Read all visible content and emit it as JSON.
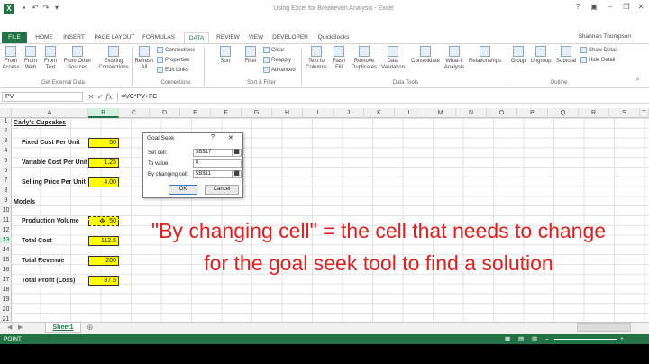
{
  "window": {
    "title": "Using Excel for Breakeven Analysis - Excel",
    "user": "Shannan Thompson"
  },
  "tabs": [
    "FILE",
    "HOME",
    "INSERT",
    "PAGE LAYOUT",
    "FORMULAS",
    "DATA",
    "REVIEW",
    "VIEW",
    "DEVELOPER",
    "QuickBooks"
  ],
  "active_tab": "DATA",
  "ribbon": {
    "get_external": {
      "buttons": [
        "From Access",
        "From Web",
        "From Text",
        "From Other Sources",
        "Existing Connections"
      ],
      "label": "Get External Data"
    },
    "connections": {
      "refresh": "Refresh All",
      "small": [
        "Connections",
        "Properties",
        "Edit Links"
      ],
      "label": "Connections"
    },
    "sort_filter": {
      "sort": "Sort",
      "filter": "Filter",
      "small": [
        "Clear",
        "Reapply",
        "Advanced"
      ],
      "label": "Sort & Filter"
    },
    "data_tools": {
      "buttons": [
        "Text to Columns",
        "Flash Fill",
        "Remove Duplicates",
        "Data Validation",
        "Consolidate",
        "What-If Analysis",
        "Relationships"
      ],
      "label": "Data Tools"
    },
    "outline": {
      "buttons": [
        "Group",
        "Ungroup",
        "Subtotal"
      ],
      "small": [
        "Show Detail",
        "Hide Detail"
      ],
      "label": "Outline"
    }
  },
  "formula_bar": {
    "name_box": "PV",
    "formula": "=VC*PV+FC"
  },
  "columns": [
    "A",
    "B",
    "C",
    "D",
    "E",
    "F",
    "G",
    "H",
    "I",
    "J",
    "K",
    "L",
    "M",
    "N",
    "O",
    "P",
    "Q",
    "R",
    "S",
    "T"
  ],
  "rows": [
    "1",
    "2",
    "3",
    "4",
    "5",
    "6",
    "7",
    "8",
    "9",
    "10",
    "11",
    "12",
    "13",
    "14",
    "15",
    "16",
    "17",
    "18",
    "19",
    "20",
    "21"
  ],
  "sheet": {
    "title": "Carly's Cupcakes",
    "fixed_cost_label": "Fixed Cost Per Unit",
    "fixed_cost": "50",
    "variable_cost_label": "Variable Cost Per Unit",
    "variable_cost": "1.25",
    "selling_price_label": "Selling Price Per Unit",
    "selling_price": "4.00",
    "models_label": "Models",
    "production_volume_label": "Production Volume",
    "production_volume": "50",
    "total_cost_label": "Total Cost",
    "total_cost": "112.5",
    "total_revenue_label": "Total Revenue",
    "total_revenue": "200",
    "total_profit_label": "Total Profit (Loss)",
    "total_profit": "87.5"
  },
  "dialog": {
    "title": "Goal Seek",
    "help": "?",
    "close": "✕",
    "set_cell_label": "Set cell:",
    "set_cell_value": "$B$17",
    "to_value_label": "To value:",
    "to_value_value": "0",
    "by_changing_label": "By changing cell:",
    "by_changing_value": "$B$11",
    "ok": "OK",
    "cancel": "Cancel"
  },
  "annotation": "\"By changing cell\" = the cell that needs to change for the goal seek tool to find a solution",
  "sheet_tab": "Sheet1",
  "status": "POINT",
  "colors": {
    "excel_green": "#217346",
    "highlight": "#ffff00",
    "annotation": "#e02020"
  }
}
